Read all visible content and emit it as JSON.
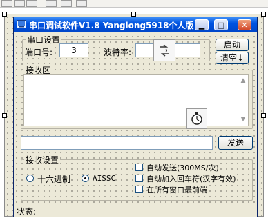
{
  "window": {
    "title": "串口调试软件V1.8 Yanglong5918个人版",
    "controls": {
      "minimize": "▁",
      "maximize": "□",
      "close": "✕"
    }
  },
  "serial_settings": {
    "group_label": "串口设置",
    "port_label": "端口号:",
    "port_value": "3",
    "baud_label": "波特率:",
    "baud_value": "",
    "start_button": "启动",
    "clear_button": "清空↓"
  },
  "receive_area": {
    "group_label": "接收区",
    "content": ""
  },
  "send": {
    "input_value": "",
    "send_button": "发送"
  },
  "receive_settings": {
    "group_label": "接收设置",
    "hex_option": "十六进制",
    "ascii_option": "AISSC",
    "selected": "AISSC",
    "auto_send": "自动发送(300MS/次)",
    "add_newline": "自动加入回车符(汉字有效)",
    "always_on_top": "在所有窗口最前端"
  },
  "status": {
    "label": "状态:"
  },
  "icons": [
    "serial-port-component-icon",
    "timer-component-icon",
    "app-icon"
  ],
  "colors": {
    "titlebar": "#0053e1",
    "form_bg": "#ece9d8"
  }
}
